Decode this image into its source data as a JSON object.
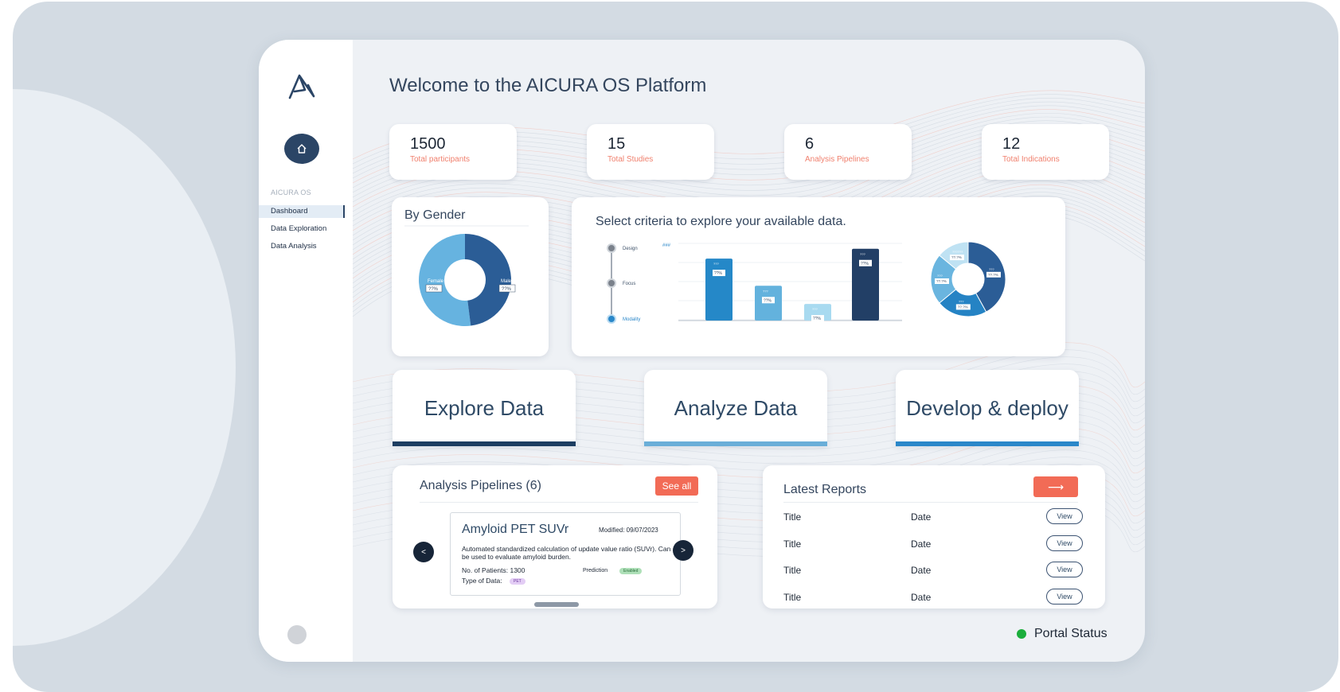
{
  "sidebar": {
    "section": "AICURA OS",
    "items": [
      "Dashboard",
      "Data Exploration",
      "Data Analysis"
    ]
  },
  "header": {
    "title": "Welcome to the AICURA OS Platform"
  },
  "stats": [
    {
      "value": "1500",
      "label": "Total participants"
    },
    {
      "value": "15",
      "label": "Total Studies"
    },
    {
      "value": "6",
      "label": "Analysis Pipelines"
    },
    {
      "value": "12",
      "label": "Total Indications"
    }
  ],
  "gender": {
    "title": "By Gender",
    "female": {
      "label": "Female",
      "value": "??%",
      "share": 0.52
    },
    "male": {
      "label": "Male",
      "value": "??%",
      "share": 0.48
    }
  },
  "explore": {
    "title": "Select criteria to explore your available data.",
    "criteria": [
      {
        "label": "Design",
        "selected": false
      },
      {
        "label": "Focus",
        "selected": false
      },
      {
        "label": "Modality",
        "selected": true
      }
    ],
    "legend_tag": "###",
    "bars": [
      {
        "tag": "???",
        "label": "??%",
        "value": 0.82,
        "color": "#2588c8"
      },
      {
        "tag": "???",
        "label": "??%",
        "value": 0.46,
        "color": "#63b2dd"
      },
      {
        "tag": "???",
        "label": "??%",
        "value": 0.22,
        "color": "#a8daf0"
      },
      {
        "tag": "???",
        "label": "??%",
        "value": 0.95,
        "color": "#223f66"
      }
    ],
    "donut": [
      {
        "tag": "???",
        "value": "??.?%",
        "share": 0.42,
        "color": "#2b5d96"
      },
      {
        "tag": "???",
        "value": "??.?%",
        "share": 0.22,
        "color": "#2583c4"
      },
      {
        "tag": "???",
        "value": "??.?%",
        "share": 0.22,
        "color": "#6ab5df"
      },
      {
        "tag": "??????",
        "value": "??.?%",
        "share": 0.14,
        "color": "#bfe2f3"
      }
    ]
  },
  "actions": [
    {
      "label": "Explore Data",
      "color": "#1c3d61"
    },
    {
      "label": "Analyze Data",
      "color": "#6aaed8"
    },
    {
      "label": "Develop & deploy",
      "color": "#2a87c9"
    }
  ],
  "pipelines": {
    "title": "Analysis Pipelines (6)",
    "see_all": "See all",
    "prev": "<",
    "next": ">",
    "card": {
      "name": "Amyloid PET SUVr",
      "modified": "Modified: 09/07/2023",
      "description": "Automated standardized calculation of update value ratio (SUVr). Can be used to evaluate amyloid burden.",
      "patients": "No. of Patients: 1300",
      "prediction_label": "Prediction",
      "prediction_status": "Enabled",
      "data_type_label": "Type of Data:",
      "data_type": "PET"
    }
  },
  "reports": {
    "title": "Latest Reports",
    "arrow": "⟶",
    "rows": [
      {
        "title": "Title",
        "date": "Date",
        "action": "View"
      },
      {
        "title": "Title",
        "date": "Date",
        "action": "View"
      },
      {
        "title": "Title",
        "date": "Date",
        "action": "View"
      },
      {
        "title": "Title",
        "date": "Date",
        "action": "View"
      }
    ]
  },
  "status": {
    "label": "Portal Status",
    "color": "#1bae3c"
  }
}
